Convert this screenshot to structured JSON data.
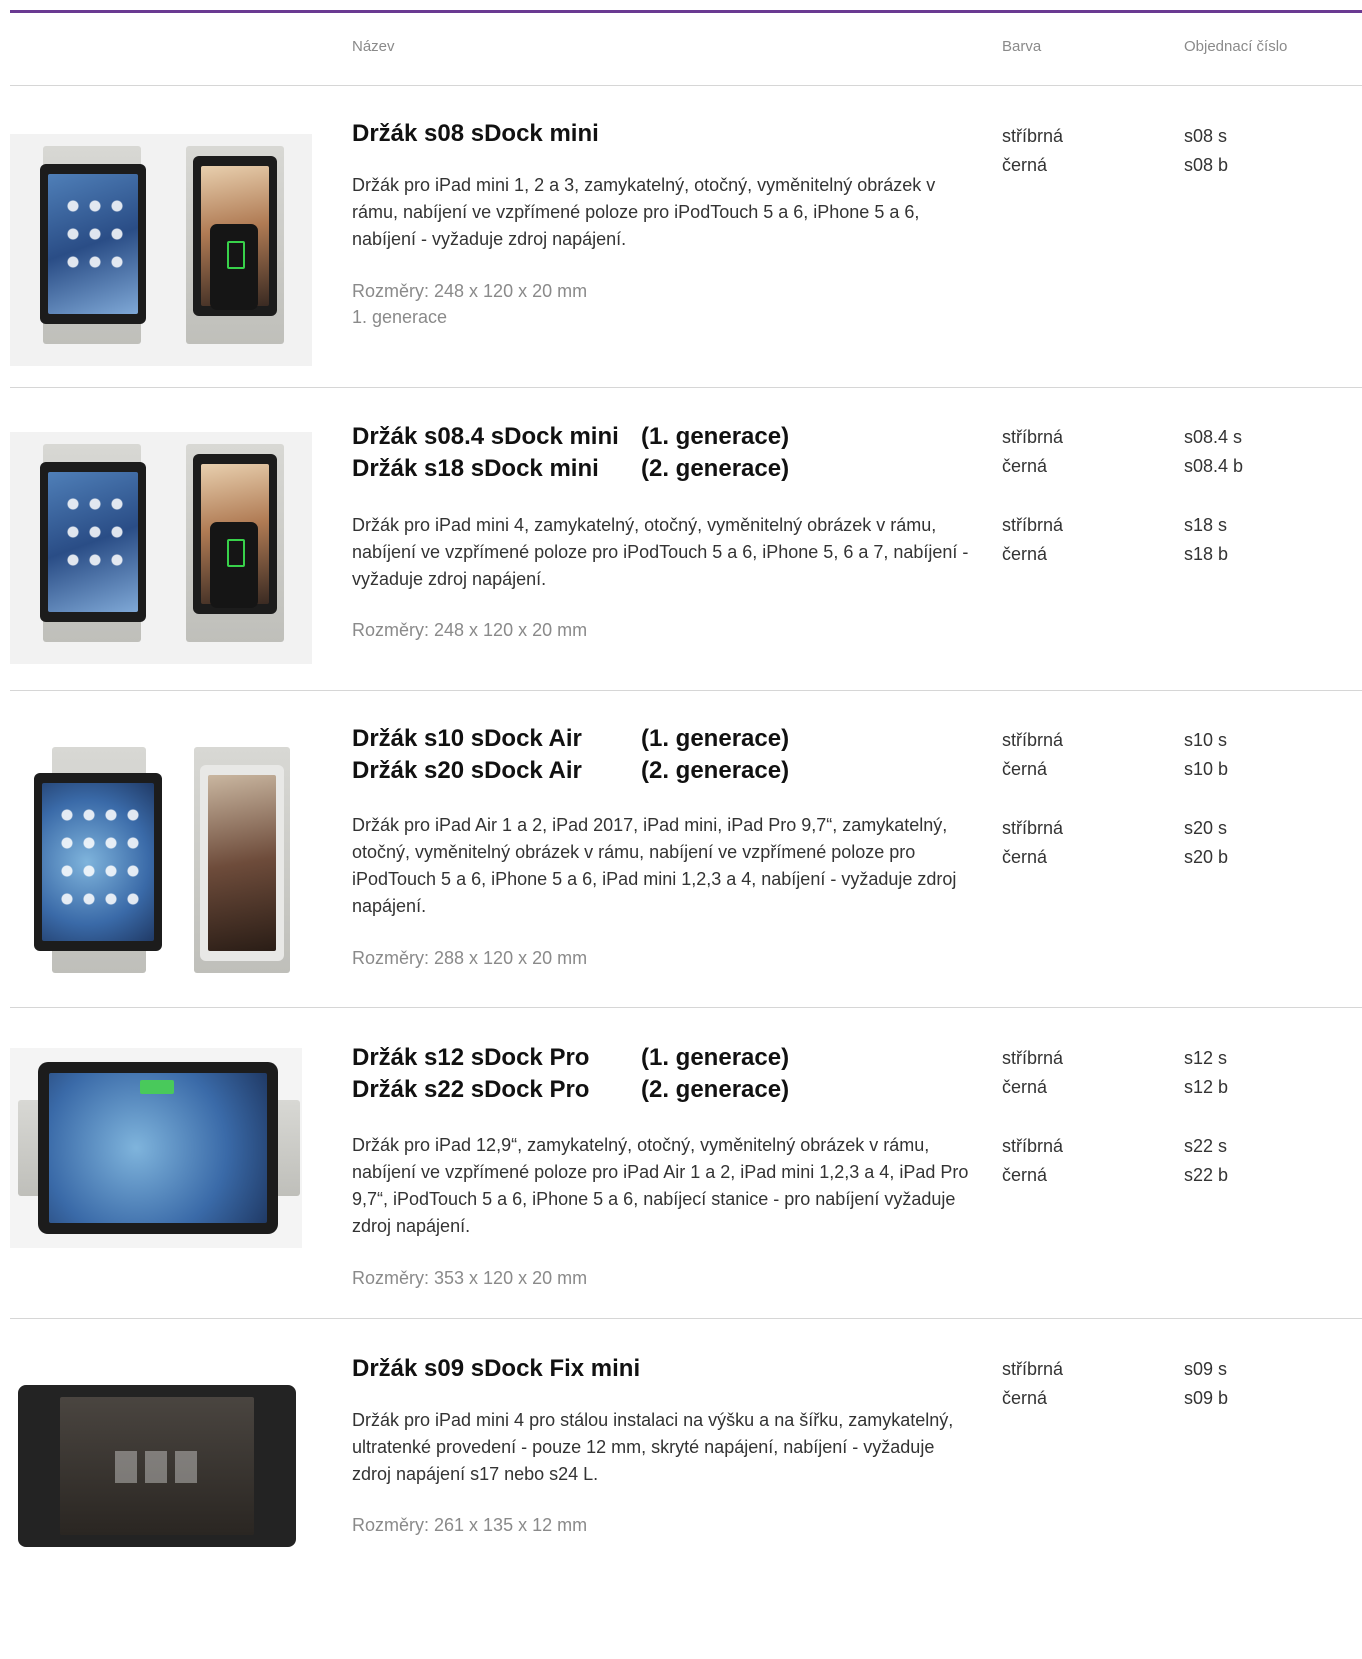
{
  "table": {
    "headers": {
      "name": "Název",
      "color": "Barva",
      "order": "Objednací číslo"
    }
  },
  "products": [
    {
      "titles": [
        {
          "name": "Držák s08 sDock mini",
          "generation": ""
        }
      ],
      "description": "Držák pro iPad mini 1, 2 a 3, zamykatelný, otočný, vyměnitelný obrázek v rámu, nabíjení ve vzpřímené poloze pro iPodTouch 5 a 6, iPhone 5 a 6, nabíjení - vyžaduje zdroj napájení.",
      "dimensions": [
        "Rozměry: 248 x 120 x 20 mm",
        "1. generace"
      ],
      "variants": [
        {
          "colors": [
            "stříbrná",
            "černá"
          ],
          "codes": [
            "s08 s",
            "s08 b"
          ]
        }
      ],
      "image": "ipad-mini-holder-image"
    },
    {
      "titles": [
        {
          "name": "Držák s08.4 sDock mini",
          "generation": "(1. generace)"
        },
        {
          "name": "Držák s18 sDock mini",
          "generation": "(2. generace)"
        }
      ],
      "description": "Držák pro iPad mini 4, zamykatelný, otočný, vyměnitelný obrázek v rámu, nabíjení ve vzpřímené poloze pro iPodTouch 5 a 6, iPhone 5, 6 a 7, nabíjení - vyžaduje zdroj napájení.",
      "dimensions": [
        "Rozměry: 248 x 120 x 20 mm"
      ],
      "variants": [
        {
          "colors": [
            "stříbrná",
            "černá"
          ],
          "codes": [
            "s08.4 s",
            "s08.4 b"
          ]
        },
        {
          "colors": [
            "stříbrná",
            "černá"
          ],
          "codes": [
            "s18 s",
            "s18 b"
          ]
        }
      ],
      "image": "ipad-mini-4-holder-image"
    },
    {
      "titles": [
        {
          "name": "Držák s10 sDock Air",
          "generation": "(1. generace)"
        },
        {
          "name": "Držák s20 sDock Air",
          "generation": "(2. generace)"
        }
      ],
      "description": "Držák pro iPad Air 1 a 2, iPad 2017, iPad mini, iPad Pro 9,7“, zamykatelný, otočný, vyměnitelný obrázek v rámu, nabíjení ve vzpřímené poloze pro iPodTouch 5 a 6, iPhone 5 a 6, iPad mini 1,2,3 a 4, nabíjení - vyžaduje zdroj napájení.",
      "dimensions": [
        "Rozměry: 288 x 120 x 20 mm"
      ],
      "variants": [
        {
          "colors": [
            "stříbrná",
            "černá"
          ],
          "codes": [
            "s10 s",
            "s10 b"
          ]
        },
        {
          "colors": [
            "stříbrná",
            "černá"
          ],
          "codes": [
            "s20 s",
            "s20 b"
          ]
        }
      ],
      "image": "ipad-air-holder-image"
    },
    {
      "titles": [
        {
          "name": "Držák s12 sDock Pro",
          "generation": "(1. generace)"
        },
        {
          "name": "Držák s22 sDock Pro",
          "generation": "(2. generace)"
        }
      ],
      "description": "Držák pro iPad 12,9“, zamykatelný, otočný, vyměnitelný obrázek v rámu, nabíjení ve vzpřímené poloze pro iPad Air 1 a 2, iPad mini 1,2,3 a 4, iPad Pro 9,7“, iPodTouch 5 a 6, iPhone 5 a 6, nabíjecí stanice - pro nabíjení vyžaduje zdroj napájení.",
      "dimensions": [
        "Rozměry: 353 x 120 x 20 mm"
      ],
      "variants": [
        {
          "colors": [
            "stříbrná",
            "černá"
          ],
          "codes": [
            "s12 s",
            "s12 b"
          ]
        },
        {
          "colors": [
            "stříbrná",
            "černá"
          ],
          "codes": [
            "s22 s",
            "s22 b"
          ]
        }
      ],
      "image": "ipad-pro-holder-image"
    },
    {
      "titles": [
        {
          "name": "Držák s09 sDock Fix mini",
          "generation": ""
        }
      ],
      "description": "Držák pro iPad mini 4 pro stálou instalaci na výšku a na šířku, zamykatelný, ultratenké provedení - pouze 12 mm, skryté napájení, nabíjení - vyžaduje zdroj napájení s17 nebo s24 L.",
      "dimensions": [
        "Rozměry: 261 x 135 x 12 mm"
      ],
      "variants": [
        {
          "colors": [
            "stříbrná",
            "černá"
          ],
          "codes": [
            "s09 s",
            "s09 b"
          ]
        }
      ],
      "image": "ipad-mini-fix-holder-image"
    }
  ]
}
